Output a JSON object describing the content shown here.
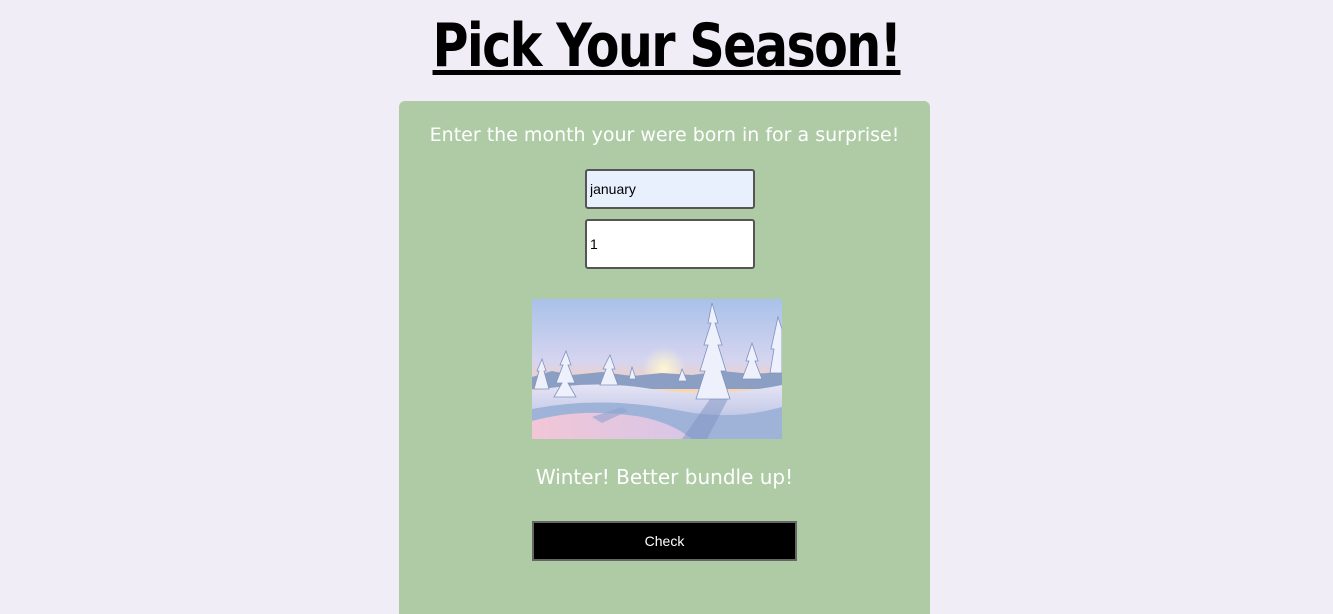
{
  "header": {
    "title": "Pick Your Season!"
  },
  "form": {
    "prompt": "Enter the month your were born in for a surprise!",
    "month_value": "january",
    "number_value": "1",
    "result_text": "Winter! Better bundle up!",
    "check_label": "Check"
  },
  "image": {
    "description_icon": "winter-landscape-image"
  },
  "colors": {
    "background": "#f0edf7",
    "card": "#aecba6",
    "button": "#000000"
  }
}
